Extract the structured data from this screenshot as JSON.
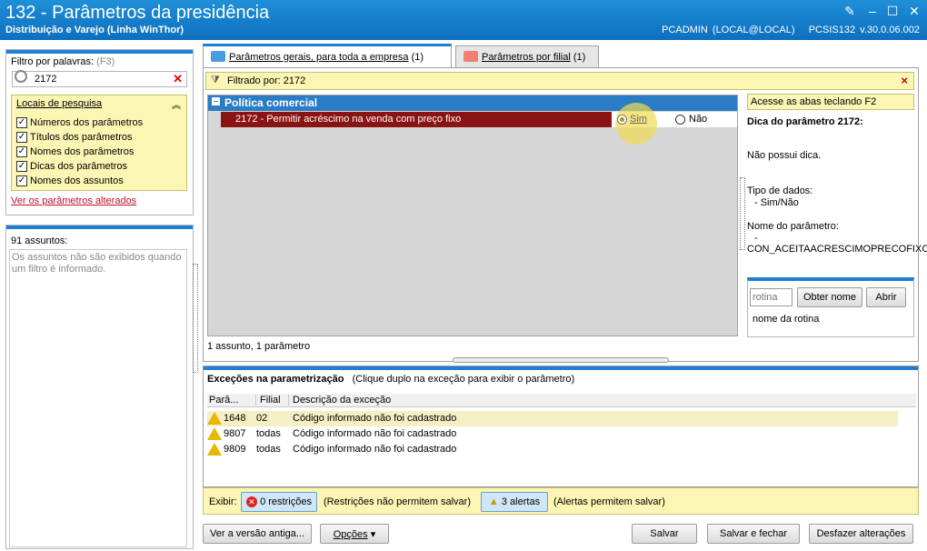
{
  "window": {
    "title": "132 - Parâmetros da presidência",
    "subtitle": "Distribuição e Varejo (Linha WinThor)",
    "user": "PCADMIN (LOCAL@LOCAL)",
    "version": "PCSIS132  v.30.0.06.002"
  },
  "filter": {
    "label": "Filtro por palavras:",
    "shortcut": "(F3)",
    "value": "2172",
    "locations_title": "Locais de pesquisa",
    "locations": [
      "Números dos parâmetros",
      "Títulos dos parâmetros",
      "Nomes dos parâmetros",
      "Dicas dos parâmetros",
      "Nomes dos assuntos"
    ],
    "changed_link": "Ver os parâmetros alterados"
  },
  "subjects": {
    "count": "91 assuntos:",
    "note": "Os assuntos não são exibidos quando um filtro é informado."
  },
  "tabs": [
    {
      "label": "Parâmetros gerais, para toda a empresa",
      "count": "(1)"
    },
    {
      "label": "Parâmetros por filial",
      "count": "(1)"
    }
  ],
  "filtered": {
    "label": "Filtrado por: 2172",
    "close": "×"
  },
  "grid": {
    "group": "Política comercial",
    "row": "2172 - Permitir acréscimo na venda com preço fixo",
    "opt_yes": "Sim",
    "opt_no": "Não",
    "summary": "1 assunto, 1 parâmetro"
  },
  "tip": {
    "access": "Acesse as abas teclando F2",
    "title": "Dica do parâmetro 2172:",
    "text": "Não possui dica.",
    "type_label": "Tipo de dados:",
    "type_value": "- Sim/Não",
    "name_label": "Nome do parâmetro:",
    "name_dash": "-",
    "name_value": "CON_ACEITAACRESCIMOPRECOFIXC"
  },
  "routine": {
    "placeholder": "rotina",
    "get_name": "Obter nome",
    "open": "Abrir",
    "name": "nome da rotina"
  },
  "exceptions": {
    "title": "Exceções na parametrização",
    "hint": "(Clique duplo na exceção para exibir o parâmetro)",
    "columns": [
      "Parâ...",
      "Filial",
      "Descrição da exceção"
    ],
    "rows": [
      {
        "param": "1648",
        "branch": "02",
        "desc": "Código informado não foi cadastrado"
      },
      {
        "param": "9807",
        "branch": "todas",
        "desc": "Código informado não foi cadastrado"
      },
      {
        "param": "9809",
        "branch": "todas",
        "desc": "Código informado não foi cadastrado"
      }
    ]
  },
  "show": {
    "label": "Exibir:",
    "restrictions": "0 restrições",
    "restrictions_note": "(Restrições não permitem salvar)",
    "alerts": "3 alertas",
    "alerts_note": "(Alertas permitem salvar)"
  },
  "buttons": {
    "old_version": "Ver a versão antiga...",
    "options": "Opções",
    "save": "Salvar",
    "save_close": "Salvar e fechar",
    "undo": "Desfazer alterações"
  }
}
